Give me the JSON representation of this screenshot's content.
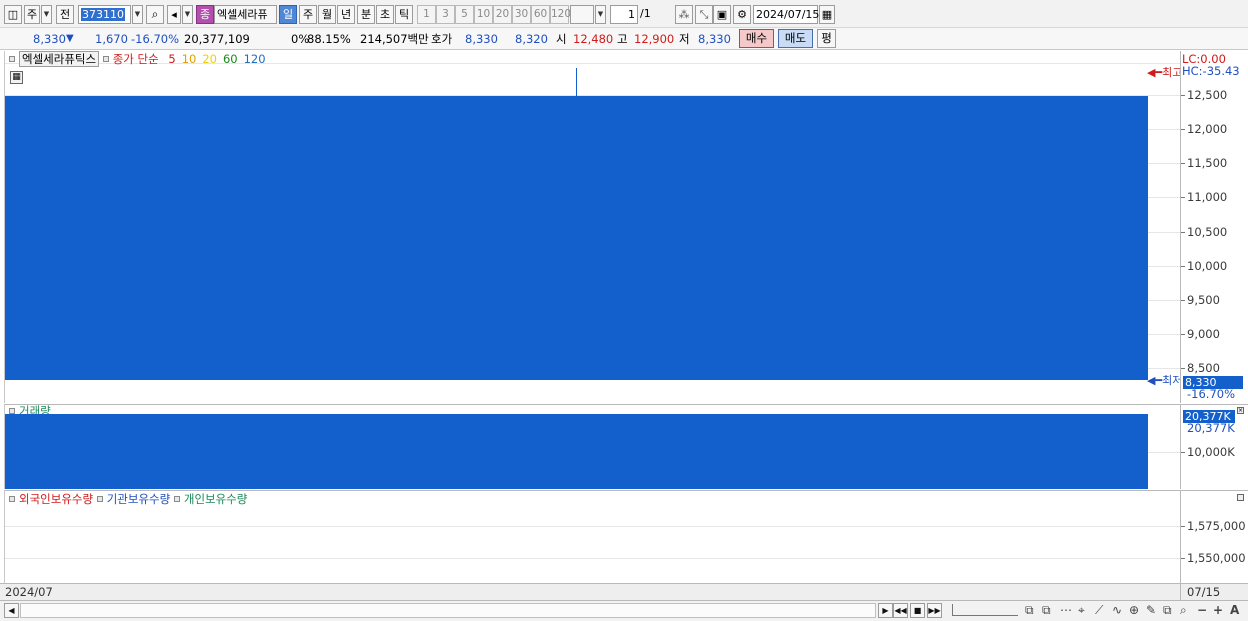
{
  "toolbar": {
    "period_code": "주",
    "prev_label": "전",
    "stock_code": "373110",
    "stock_name_button": "엑셀세라퓨",
    "badge_symbol": "종",
    "periods": [
      "일",
      "주",
      "월",
      "년",
      "분",
      "초",
      "틱"
    ],
    "active_period": "일",
    "intervals": [
      "1",
      "3",
      "5",
      "10",
      "20",
      "30",
      "60",
      "120"
    ],
    "page": "1",
    "page_total": "/1",
    "date": "2024/07/15"
  },
  "quote": {
    "price": "8,330",
    "change_dir": "▼",
    "change": "1,670",
    "change_pct": "-16.70%",
    "volume": "20,377,109",
    "ratio": "0%",
    "ratio2": "88.15%",
    "amount": "214,507백만",
    "bid_label": "호가",
    "ask": "8,330",
    "bid": "8,320",
    "open_label": "시",
    "open": "12,480",
    "high_label": "고",
    "high": "12,900",
    "low_label": "저",
    "low": "8,330",
    "buy_label": "매수",
    "sell_label": "매도",
    "eval_label": "평"
  },
  "price_pane": {
    "stock_tag": "엑셀세라퓨틱스",
    "ma_title": "종가 단순",
    "ma_periods": [
      "5",
      "10",
      "20",
      "60",
      "120"
    ],
    "ma_colors": [
      "#d11a1a",
      "#e0a000",
      "#f0d000",
      "#1a8a1a",
      "#1f6fbf"
    ],
    "lc_label": "LC:0.00",
    "hc_label": "HC:-35.43",
    "high_marker": "최고",
    "low_marker": "최저",
    "last_price": "8,330",
    "last_pct": "-16.70%",
    "candle_color": "#135fcc"
  },
  "volume_pane": {
    "title": "거래량",
    "current_label": "20,377K",
    "value_label": "20,377K",
    "ticks": [
      "10,000K"
    ]
  },
  "holdings_pane": {
    "series": [
      "외국인보유수량",
      "기관보유수량",
      "개인보유수량"
    ],
    "series_colors": [
      "#d11a1a",
      "#1f4fbf",
      "#1a8a5a"
    ],
    "ticks": [
      "1,575,000",
      "1,550,000"
    ]
  },
  "chart_data": [
    {
      "type": "bar",
      "title": "",
      "categories": [
        "2024/07/15"
      ],
      "series": [
        {
          "name": "",
          "open": 12480,
          "high": 12900,
          "low": 8330,
          "close": 8330
        }
      ],
      "y_ticks": [
        8500,
        9000,
        9500,
        10000,
        10500,
        11000,
        11500,
        12000,
        12500
      ],
      "ylim": [
        8330,
        12900
      ],
      "grid": true
    },
    {
      "type": "bar",
      "title": "",
      "categories": [
        "2024/07/15"
      ],
      "series": [
        {
          "name": "거래량",
          "values": [
            20377109
          ]
        }
      ],
      "y_ticks": [
        10000000
      ],
      "ylim": [
        0,
        20377109
      ],
      "grid": true
    }
  ],
  "date_axis": {
    "start": "2024/07",
    "end": "07/15"
  }
}
